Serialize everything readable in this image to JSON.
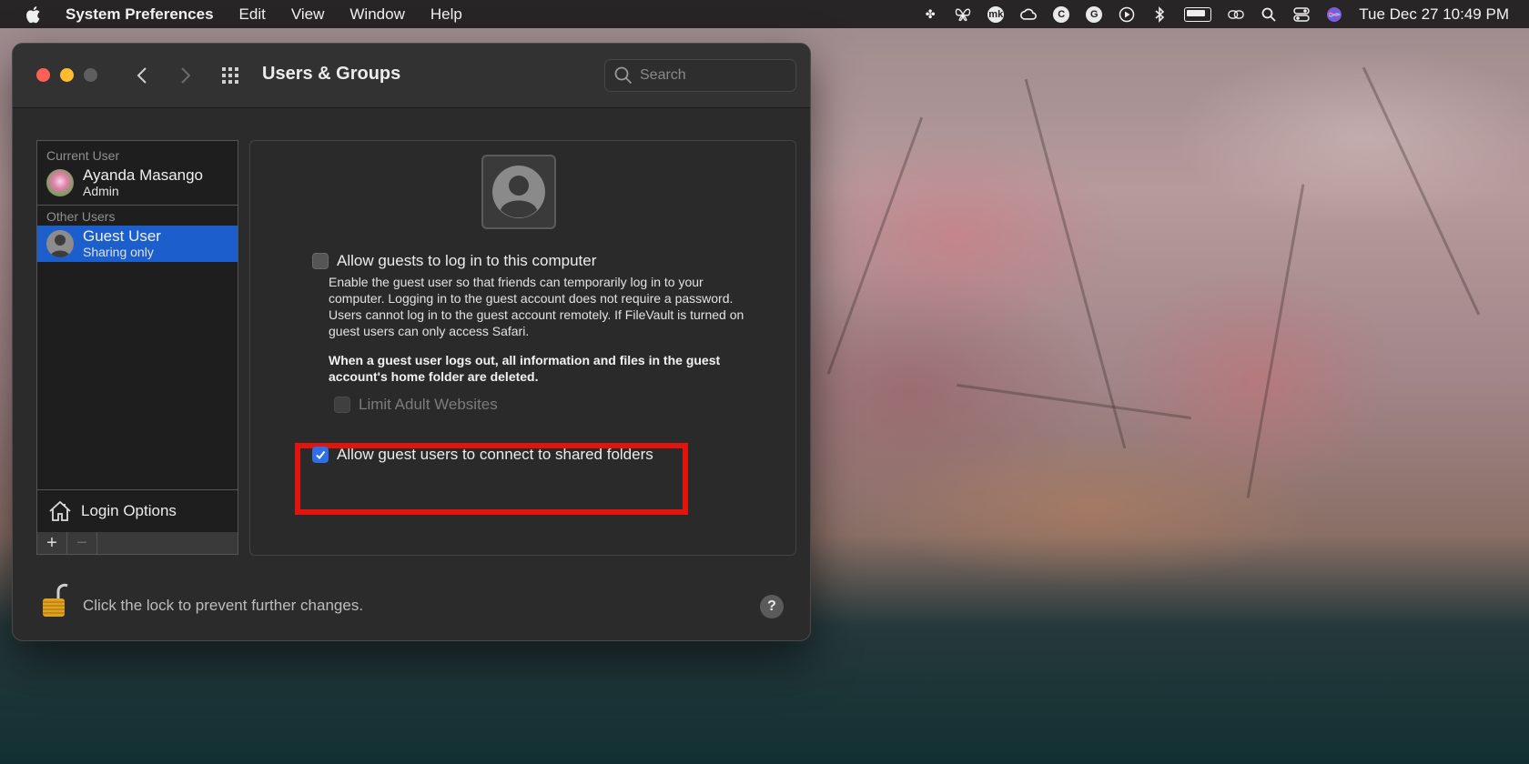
{
  "menubar": {
    "app_name": "System Preferences",
    "menus": [
      "Edit",
      "View",
      "Window",
      "Help"
    ],
    "clock": "Tue Dec 27  10:49 PM",
    "tray_icons": [
      "dropbox-icon",
      "butterfly-icon",
      "mk-icon",
      "creative-cloud-icon",
      "c-circle-icon",
      "grammarly-icon",
      "play-icon",
      "bluetooth-icon",
      "battery-icon",
      "link-icon",
      "search-icon",
      "control-center-icon",
      "siri-icon"
    ]
  },
  "window": {
    "title": "Users & Groups",
    "search": {
      "placeholder": "Search",
      "value": ""
    }
  },
  "users": {
    "current_user_label": "Current User",
    "current_user": {
      "name": "Ayanda Masango",
      "role": "Admin"
    },
    "other_users_label": "Other Users",
    "other_users": [
      {
        "name": "Guest User",
        "role": "Sharing only",
        "selected": true
      }
    ],
    "login_options_label": "Login Options",
    "add_label": "+",
    "remove_label": "−"
  },
  "guest_settings": {
    "allow_login": {
      "label": "Allow guests to log in to this computer",
      "checked": false
    },
    "description": "Enable the guest user so that friends can temporarily log in to your computer. Logging in to the guest account does not require a password. Users cannot log in to the guest account remotely. If FileVault is turned on guest users can only access Safari.",
    "warning": "When a guest user logs out, all information and files in the guest account's home folder are deleted.",
    "limit_adult": {
      "label": "Limit Adult Websites",
      "checked": false,
      "enabled": false
    },
    "shared_folders": {
      "label": "Allow guest users to connect to shared folders",
      "checked": true
    },
    "highlight_color": "#e3140d"
  },
  "footer": {
    "lock_text": "Click the lock to prevent further changes.",
    "help_label": "?"
  },
  "colors": {
    "selection": "#1c5fcc",
    "checkbox_checked": "#2f6fe5"
  }
}
